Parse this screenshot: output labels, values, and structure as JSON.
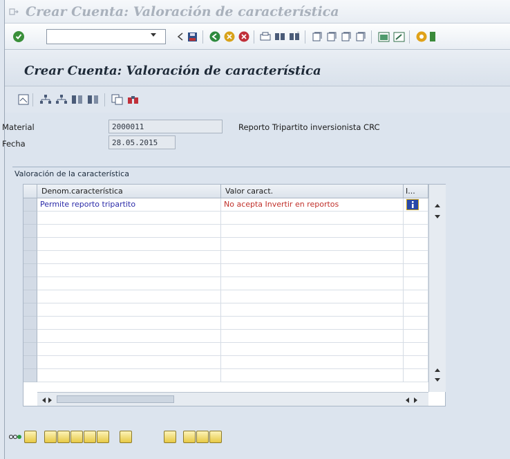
{
  "window": {
    "title": "Crear Cuenta: Valoración de característica"
  },
  "toolbar": {
    "command_value": ""
  },
  "screen": {
    "title": "Crear Cuenta: Valoración de característica"
  },
  "header": {
    "material_label": "Material",
    "material_value": "2000011",
    "material_desc": "Reporto Tripartito inversionista CRC",
    "fecha_label": "Fecha",
    "fecha_value": "28.05.2015"
  },
  "group": {
    "title": "Valoración de la característica"
  },
  "table": {
    "columns": [
      "Denom.característica",
      "Valor caract.",
      "I..."
    ],
    "rows": [
      {
        "name": "Permite reporto tripartito",
        "value": "No acepta Invertir en reportos"
      }
    ],
    "empty_rows": 14
  },
  "colors": {
    "row_name": "#2a2aa8",
    "row_value": "#c0302a",
    "title": "#1e2a38",
    "button_yellow": "#e7c945"
  },
  "icons": {
    "window": "doc-arrow-icon",
    "enter": "green-check-icon",
    "back": "back-icon",
    "exit": "exit-icon",
    "cancel": "cancel-icon"
  }
}
